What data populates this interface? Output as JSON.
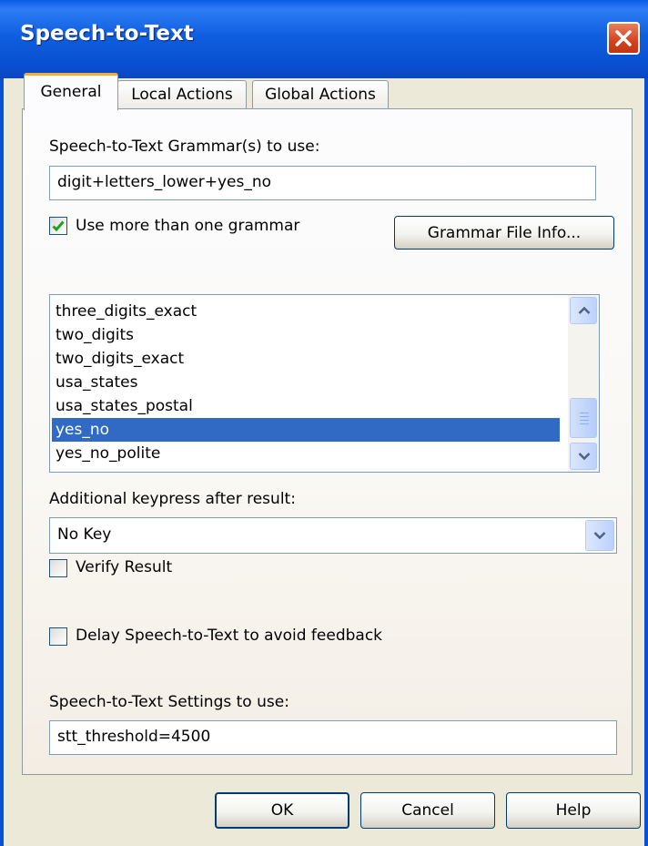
{
  "window": {
    "title": "Speech-to-Text"
  },
  "tabs": [
    {
      "label": "General",
      "active": true
    },
    {
      "label": "Local Actions",
      "active": false
    },
    {
      "label": "Global Actions",
      "active": false
    }
  ],
  "general": {
    "grammar_label": "Speech-to-Text Grammar(s) to use:",
    "grammar_value": "digit+letters_lower+yes_no",
    "multi_grammar_label": "Use more than one grammar",
    "multi_grammar_checked": true,
    "grammar_info_button": "Grammar File Info...",
    "grammar_list": {
      "items": [
        "three_digits_exact",
        "two_digits",
        "two_digits_exact",
        "usa_states",
        "usa_states_postal",
        "yes_no",
        "yes_no_polite"
      ],
      "selected": "yes_no"
    },
    "keypress_label": "Additional keypress after result:",
    "keypress_value": "No Key",
    "verify_label": "Verify Result",
    "verify_checked": false,
    "delay_label": "Delay Speech-to-Text to avoid feedback",
    "delay_checked": false,
    "settings_label": "Speech-to-Text Settings to use:",
    "settings_value": "stt_threshold=4500"
  },
  "buttons": {
    "ok": "OK",
    "cancel": "Cancel",
    "help": "Help"
  },
  "icons": {
    "close": "close-icon",
    "check": "checkmark-icon",
    "scroll_up": "chevron-up-icon",
    "scroll_down": "chevron-down-icon",
    "dropdown": "chevron-down-icon"
  },
  "colors": {
    "titlebar": "#0A50D2",
    "close_button": "#D44220",
    "selection": "#316AC5",
    "active_tab_accent": "#F3AC36",
    "dialog_face": "#ECE9D8",
    "checkmark": "#21A121"
  }
}
